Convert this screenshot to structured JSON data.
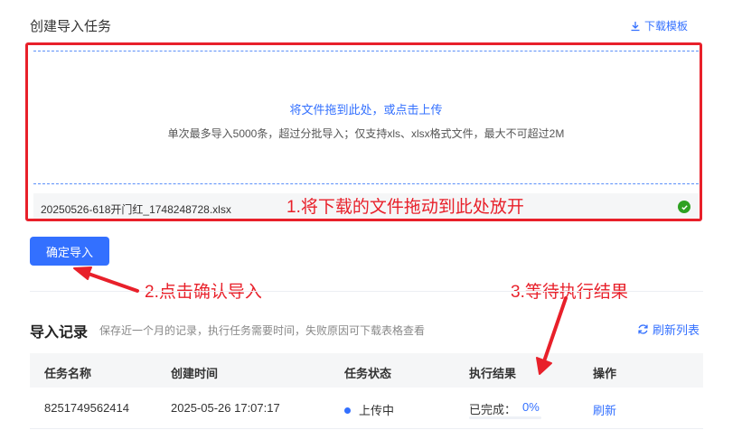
{
  "header": {
    "title": "创建导入任务",
    "download_label": "下载模板"
  },
  "dropzone": {
    "main_text": "将文件拖到此处，或点击上传",
    "hint_text": "单次最多导入5000条，超过分批导入；仅支持xls、xlsx格式文件，最大不可超过2M"
  },
  "file": {
    "name": "20250526-618开门红_1748248728.xlsx",
    "status_icon": "check-circle-icon"
  },
  "confirm_button": {
    "label": "确定导入"
  },
  "annotations": {
    "step1": "1.将下载的文件拖动到此处放开",
    "step2": "2.点击确认导入",
    "step3": "3.等待执行结果"
  },
  "records": {
    "title": "导入记录",
    "hint": "保存近一个月的记录，执行任务需要时间，失败原因可下载表格查看",
    "refresh_label": "刷新列表",
    "columns": [
      "任务名称",
      "创建时间",
      "任务状态",
      "执行结果",
      "操作"
    ],
    "rows": [
      {
        "name": "8251749562414",
        "created": "2025-05-26 17:07:17",
        "status": "上传中",
        "result_label": "已完成：",
        "result_value": "0%",
        "progress": 0,
        "action": "刷新"
      }
    ]
  },
  "colors": {
    "primary": "#3370ff",
    "annotation": "#e8202a",
    "success": "#2ea121"
  }
}
